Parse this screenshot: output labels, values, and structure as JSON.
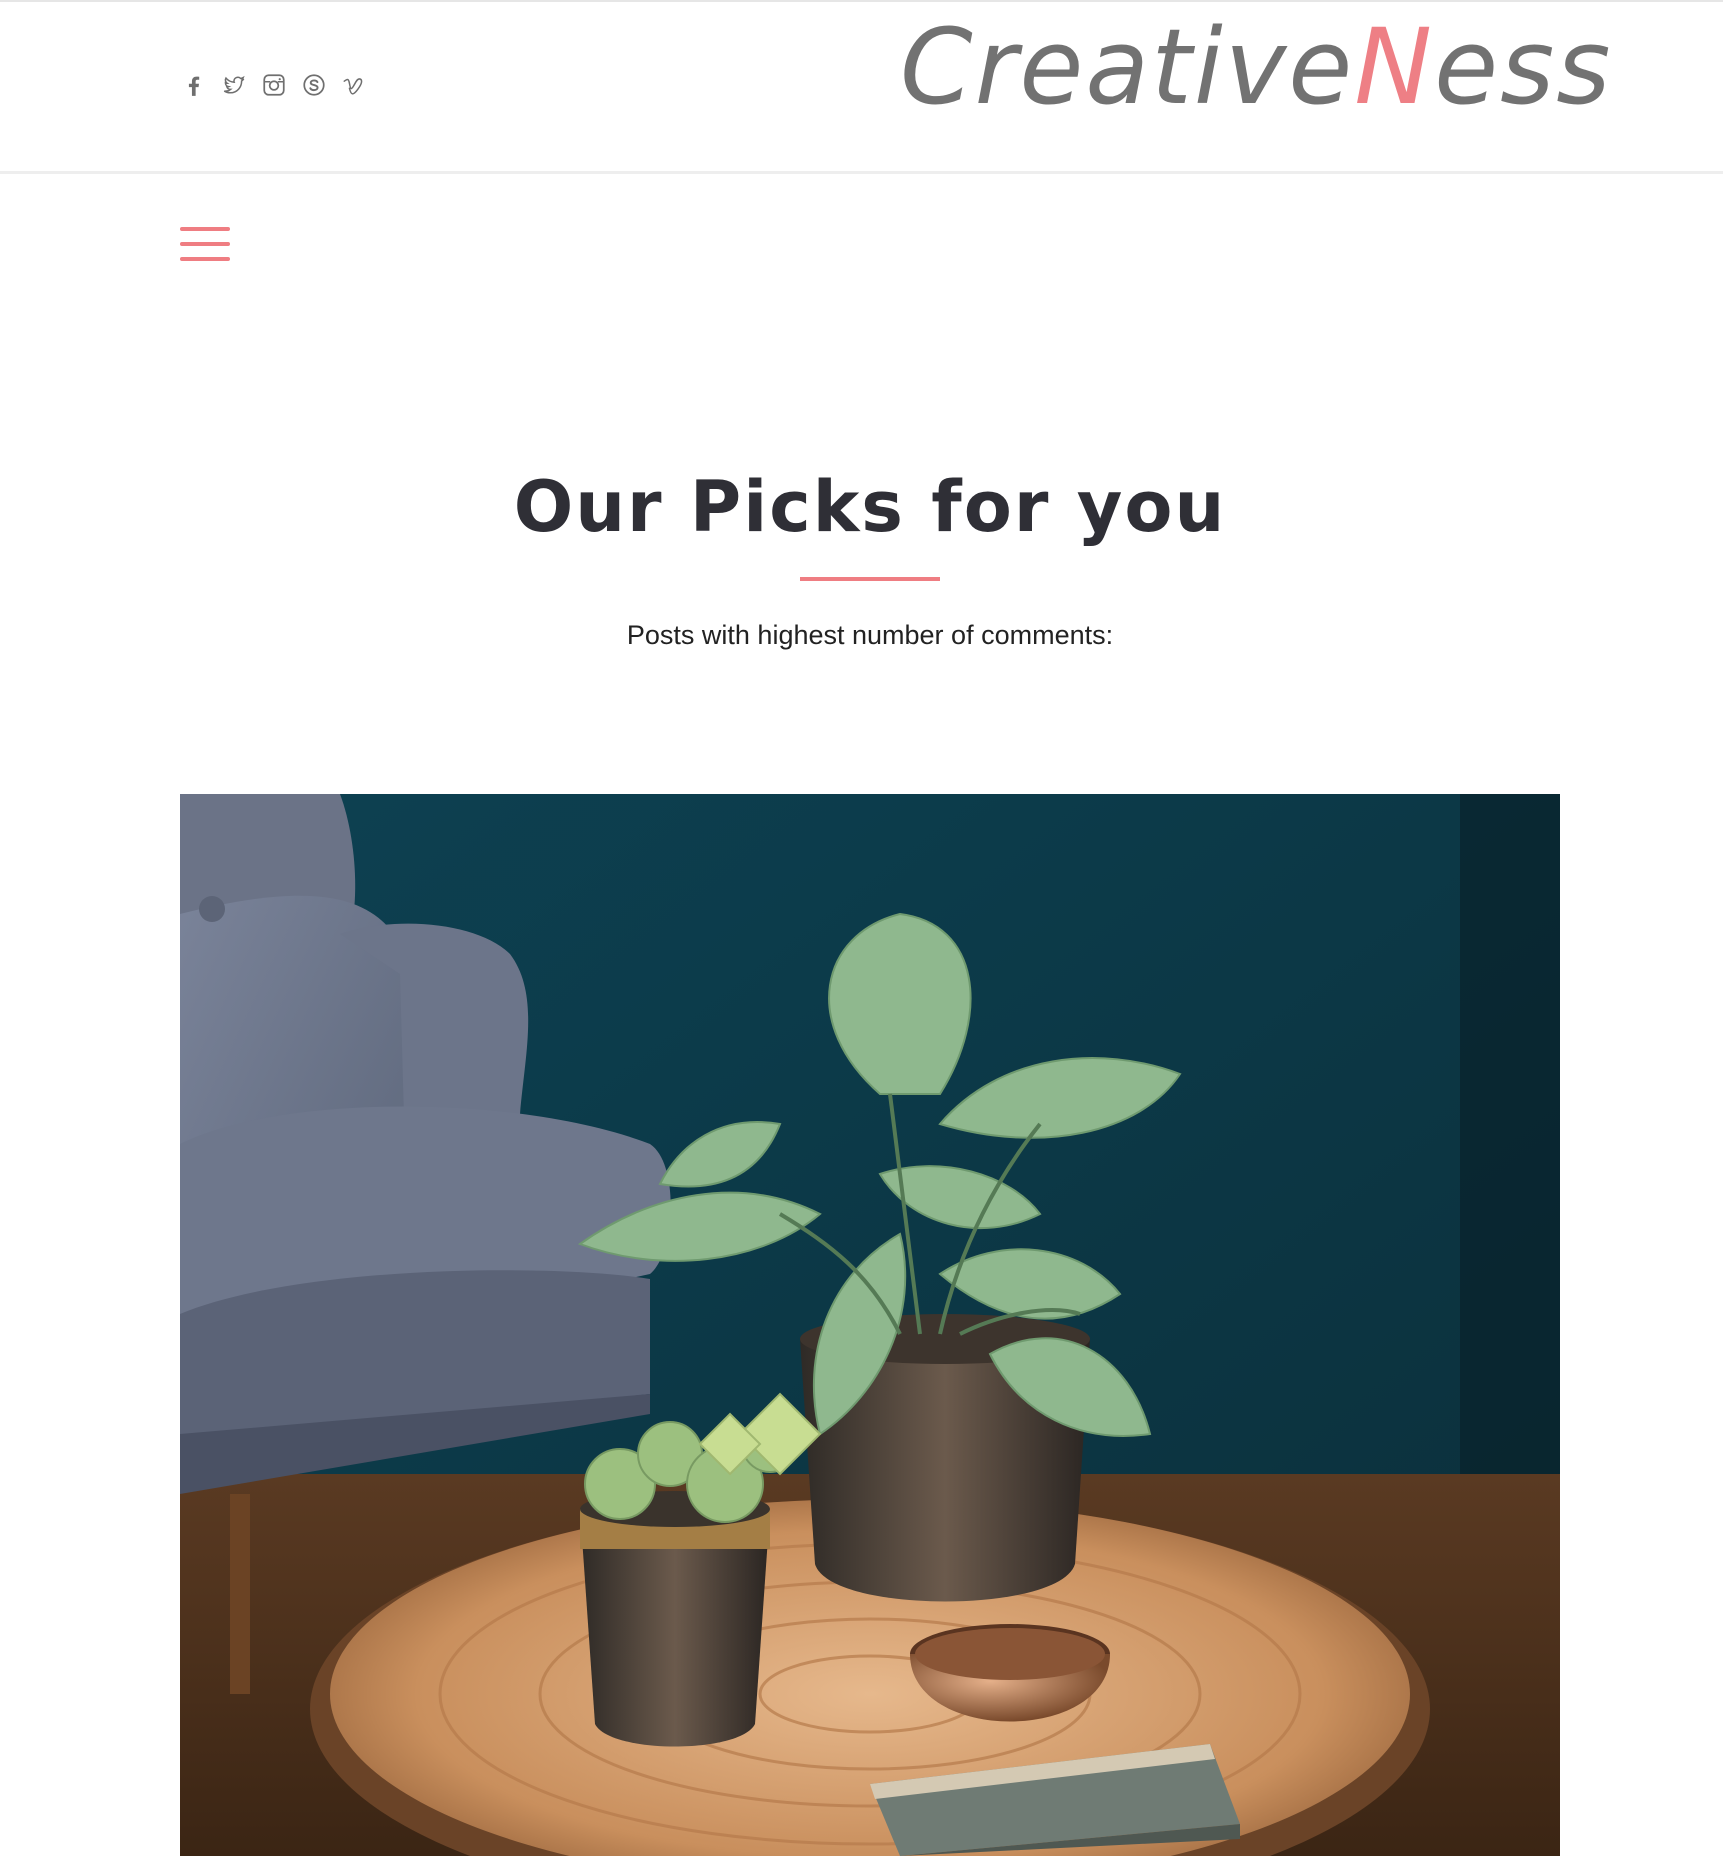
{
  "header": {
    "social": [
      {
        "icon": "facebook-icon"
      },
      {
        "icon": "twitter-icon"
      },
      {
        "icon": "instagram-icon"
      },
      {
        "icon": "skype-icon"
      },
      {
        "icon": "vimeo-icon"
      }
    ],
    "logo": {
      "part1": "Creative",
      "part2": "N",
      "part3": "ess"
    }
  },
  "menu": {
    "icon": "hamburger-menu-icon"
  },
  "section": {
    "title": "Our Picks for you",
    "subtitle": "Posts with highest number of comments:"
  },
  "featured": {
    "image": "plant-on-wooden-table-photo"
  },
  "colors": {
    "accent": "#ef7d82",
    "logo_gray": "#727272",
    "title": "#2f2f36",
    "icon_gray": "#6f6f6f"
  }
}
